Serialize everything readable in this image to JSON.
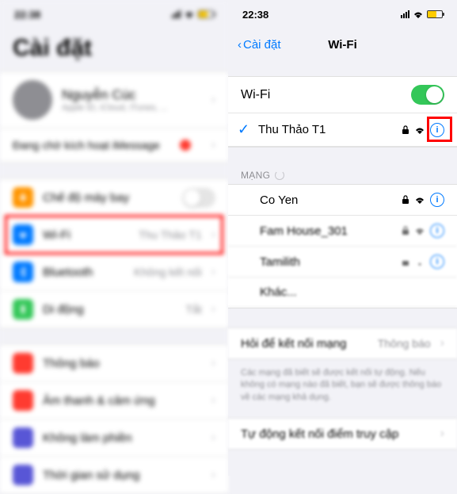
{
  "left": {
    "status_time": "22:38",
    "large_title": "Cài đặt",
    "profile_name": "Nguyễn Cúc",
    "profile_sub": "Apple ID, iCloud, iTunes, ...",
    "status_text": "Đang chờ kích hoạt iMessage",
    "rows": {
      "airplane": "Chế độ máy bay",
      "wifi": "Wi-Fi",
      "wifi_value": "Thu Thảo T1",
      "bluetooth": "Bluetooth",
      "bluetooth_value": "Không kết nối",
      "cellular": "Di động",
      "cellular_value": "Tắt"
    }
  },
  "right": {
    "status_time": "22:38",
    "back_label": "Cài đặt",
    "nav_title": "Wi-Fi",
    "wifi_toggle_label": "Wi-Fi",
    "connected_network": "Thu Thảo T1",
    "section_mang": "MẠNG",
    "networks": [
      {
        "name": "Co Yen"
      },
      {
        "name": "Fam House_301"
      },
      {
        "name": "Tamilith"
      },
      {
        "name": "Khác..."
      }
    ],
    "ask_label": "Hỏi để kết nối mạng",
    "ask_value": "Thông báo",
    "ask_footer": "Các mạng đã biết sẽ được kết nối tự động. Nếu không có mạng nào đã biết, bạn sẽ được thông báo về các mạng khả dụng.",
    "auto_label": "Tự động kết nối điểm truy cập"
  }
}
